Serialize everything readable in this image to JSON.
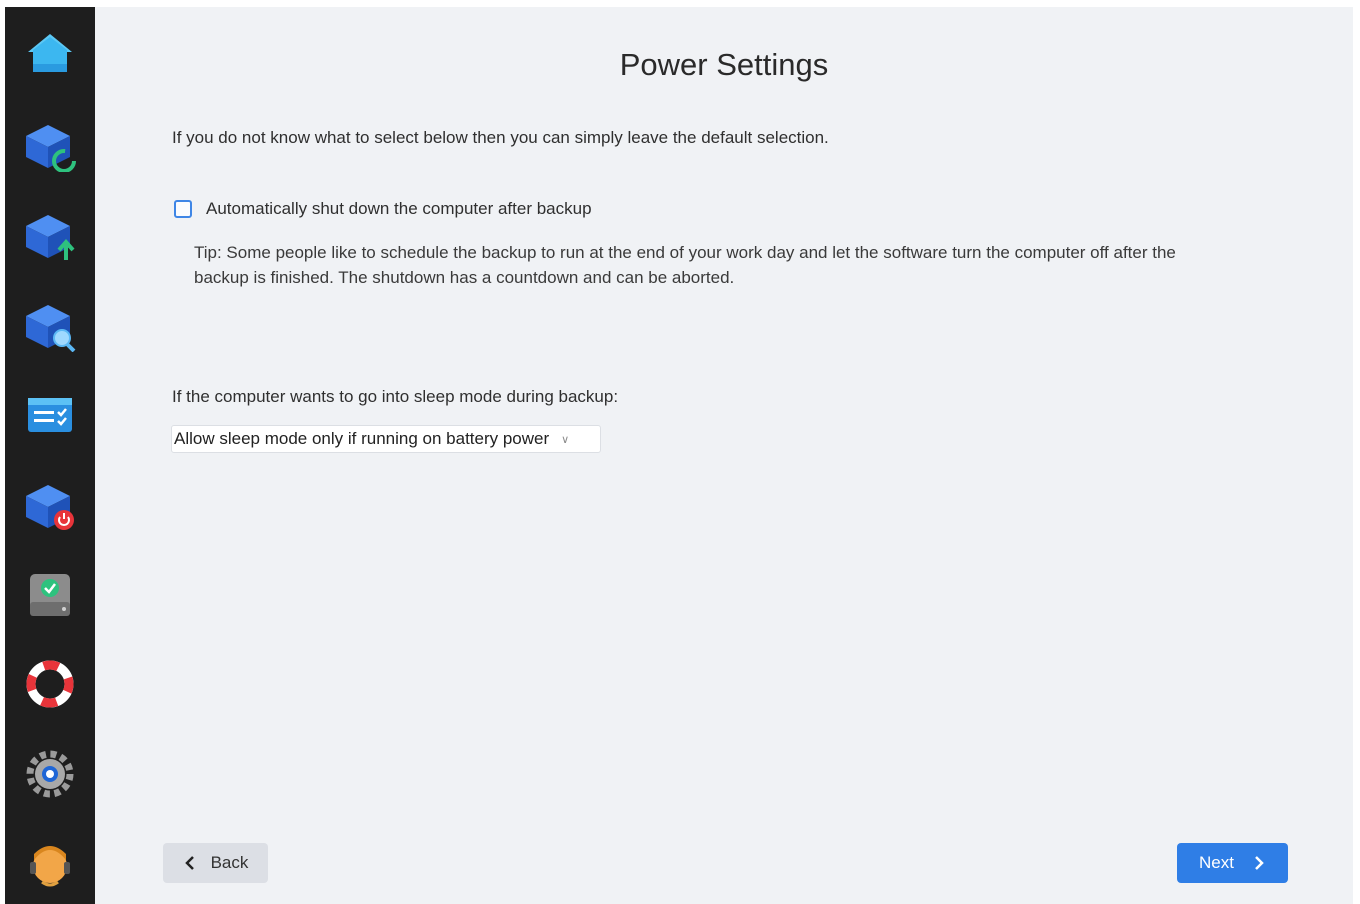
{
  "sidebar": {
    "items": [
      {
        "name": "home",
        "icon": "home-icon"
      },
      {
        "name": "backup-refresh",
        "icon": "cube-refresh-icon"
      },
      {
        "name": "backup-upload",
        "icon": "cube-upload-icon"
      },
      {
        "name": "backup-search",
        "icon": "cube-search-icon"
      },
      {
        "name": "task-list",
        "icon": "task-list-icon"
      },
      {
        "name": "backup-power",
        "icon": "cube-power-icon"
      },
      {
        "name": "disk-check",
        "icon": "disk-check-icon"
      },
      {
        "name": "help",
        "icon": "lifebuoy-icon"
      },
      {
        "name": "settings",
        "icon": "gear-icon"
      },
      {
        "name": "support-agent",
        "icon": "support-agent-icon"
      }
    ]
  },
  "page": {
    "title": "Power Settings",
    "intro": "If you do not know what to select below then you can simply leave the default selection."
  },
  "shutdown": {
    "label": "Automatically shut down the computer after backup",
    "checked": false,
    "tip_line1": "Tip: Some people like to schedule the backup to run at the end of your work day and let the software turn the computer off after the",
    "tip_line2": "backup is finished. The shutdown has a countdown and can be aborted."
  },
  "sleep": {
    "label": "If the computer wants to go into sleep mode during backup:",
    "selected": "Allow sleep mode only if running on battery power"
  },
  "nav": {
    "back_label": "Back",
    "next_label": "Next"
  },
  "colors": {
    "accent": "#2f7ee6",
    "sidebar_bg": "#1e1e1e",
    "page_bg": "#f0f2f5"
  }
}
